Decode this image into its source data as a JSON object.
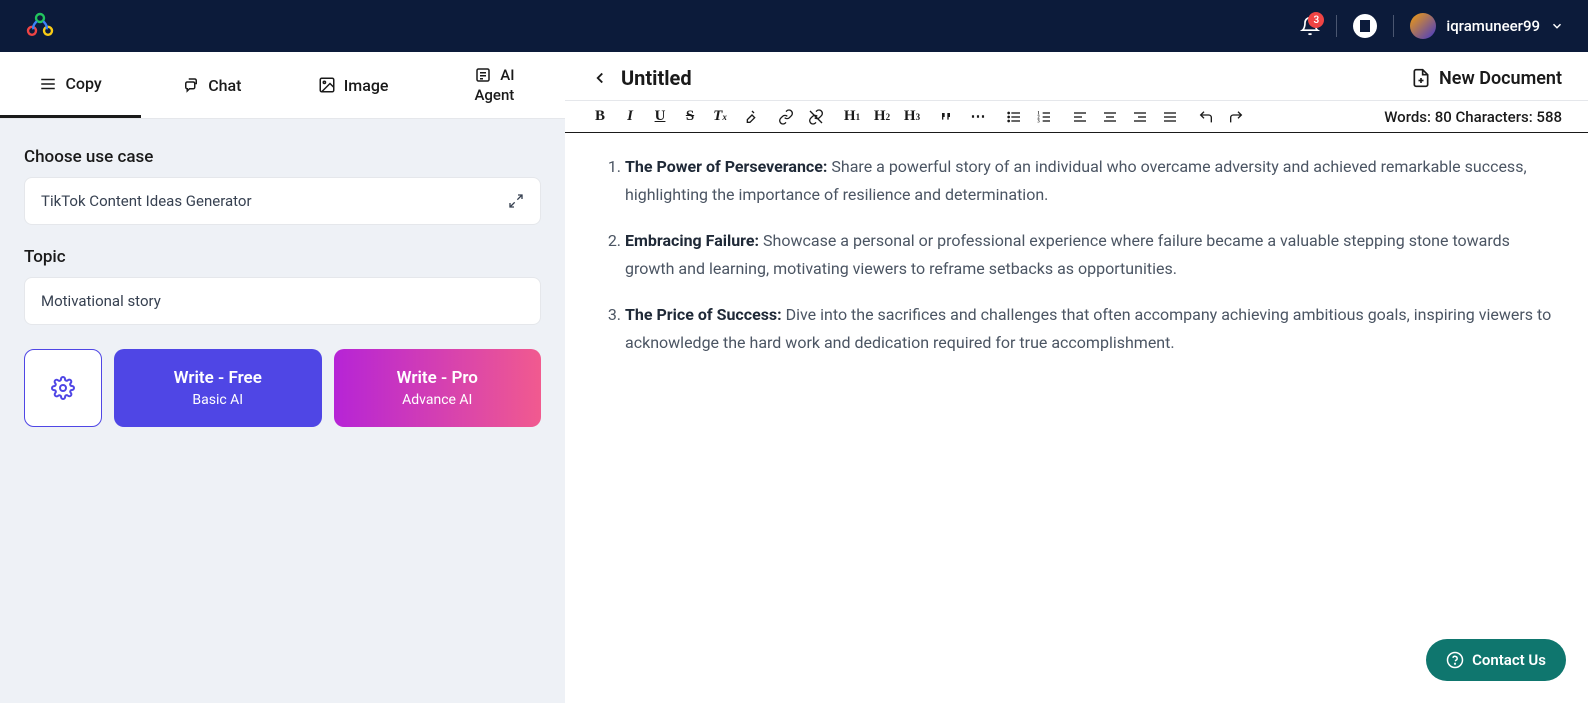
{
  "header": {
    "notif_count": "3",
    "username": "iqramuneer99"
  },
  "tabs": {
    "copy": "Copy",
    "chat": "Chat",
    "image": "Image",
    "ai": "AI",
    "agent": "Agent"
  },
  "sidebar": {
    "usecase_label": "Choose use case",
    "usecase_value": "TikTok Content Ideas Generator",
    "topic_label": "Topic",
    "topic_value": "Motivational story",
    "write_free_title": "Write - Free",
    "write_free_sub": "Basic AI",
    "write_pro_title": "Write - Pro",
    "write_pro_sub": "Advance AI"
  },
  "editor": {
    "title": "Untitled",
    "new_doc": "New Document",
    "words_label": "Words: ",
    "words": "80",
    "chars_label": " Characters: ",
    "chars": "588",
    "items": [
      {
        "title": "The Power of Perseverance: ",
        "body": "Share a powerful story of an individual who overcame adversity and achieved remarkable success, highlighting the importance of resilience and determination."
      },
      {
        "title": "Embracing Failure: ",
        "body": "Showcase a personal or professional experience where failure became a valuable stepping stone towards growth and learning, motivating viewers to reframe setbacks as opportunities."
      },
      {
        "title": "The Price of Success: ",
        "body": "Dive into the sacrifices and challenges that often accompany achieving ambitious goals, inspiring viewers to acknowledge the hard work and dedication required for true accomplishment."
      }
    ]
  },
  "contact": "Contact Us"
}
